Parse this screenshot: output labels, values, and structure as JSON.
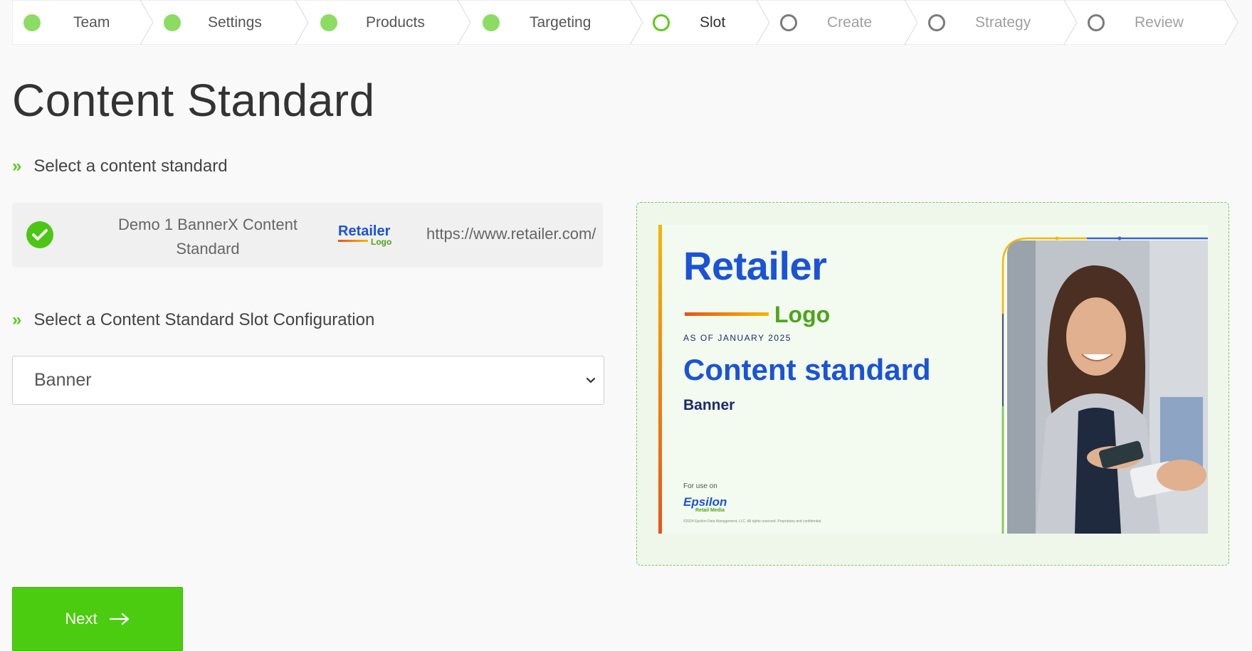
{
  "stepper": {
    "steps": [
      {
        "label": "Team",
        "state": "done"
      },
      {
        "label": "Settings",
        "state": "done"
      },
      {
        "label": "Products",
        "state": "done"
      },
      {
        "label": "Targeting",
        "state": "done"
      },
      {
        "label": "Slot",
        "state": "current"
      },
      {
        "label": "Create",
        "state": "todo"
      },
      {
        "label": "Strategy",
        "state": "todo"
      },
      {
        "label": "Review",
        "state": "todo"
      }
    ]
  },
  "page": {
    "title": "Content Standard",
    "section1_heading": "Select a content standard",
    "section2_heading": "Select a Content Standard Slot Configuration"
  },
  "content_standard": {
    "name": "Demo 1 BannerX Content Standard",
    "logo_text": "Retailer",
    "logo_subtext": "Logo",
    "url": "https://www.retailer.com/",
    "selected": true
  },
  "slot_select": {
    "value": "Banner"
  },
  "preview": {
    "brand_name": "Retailer",
    "brand_sub": "Logo",
    "as_of": "AS OF JANUARY 2025",
    "headline": "Content standard",
    "subheadline": "Banner",
    "for_use_on": "For use on",
    "epsilon_name": "Epsilon",
    "epsilon_sub": "Retail Media",
    "fine_print": "©2024 Epsilon Data Management, LLC. All rights reserved. Proprietary and confidential."
  },
  "actions": {
    "next_label": "Next"
  },
  "colors": {
    "accent_green": "#4ccc10",
    "brand_blue": "#1a53d6",
    "brand_green": "#4ca51a"
  }
}
